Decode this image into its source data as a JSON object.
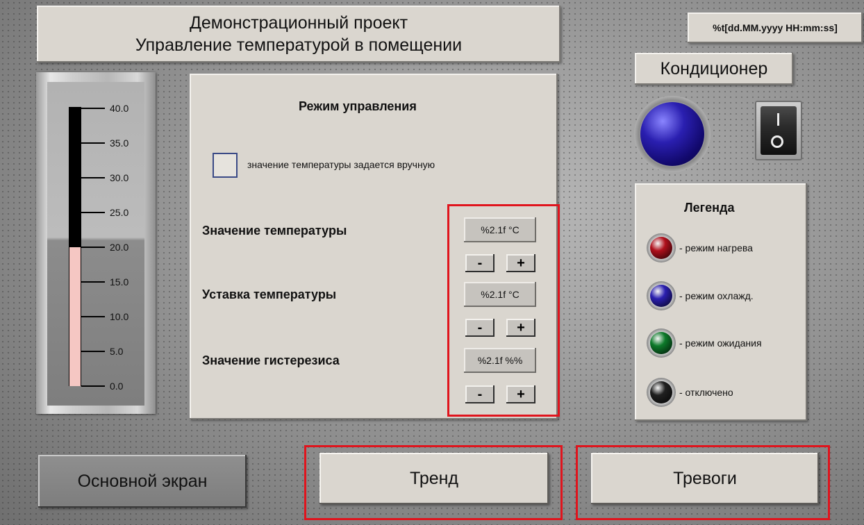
{
  "title": {
    "line1": "Демонстрационный проект",
    "line2": "Управление температурой в помещении"
  },
  "datetime_format": "%t[dd.MM.yyyy  HH:mm:ss]",
  "thermometer": {
    "scale": [
      "40.0",
      "35.0",
      "30.0",
      "25.0",
      "20.0",
      "15.0",
      "10.0",
      "5.0",
      "0.0"
    ],
    "level_celsius": 20.0,
    "max_celsius": 40.0
  },
  "mode": {
    "title": "Режим управления",
    "manual_checkbox_label": "значение температуры задается вручную",
    "manual_checked": false,
    "params": [
      {
        "label": "Значение температуры",
        "value": "%2.1f °C",
        "minus": "-",
        "plus": "+"
      },
      {
        "label": "Уставка температуры",
        "value": "%2.1f °C",
        "minus": "-",
        "plus": "+"
      },
      {
        "label": "Значение гистерезиса",
        "value": "%2.1f %%",
        "minus": "-",
        "plus": "+"
      }
    ]
  },
  "conditioner": {
    "title": "Кондиционер",
    "lamp_color": "#2a1fb0"
  },
  "legend": {
    "title": "Легенда",
    "items": [
      {
        "text": "- режим нагрева",
        "color": "#b0101c"
      },
      {
        "text": "- режим охлажд.",
        "color": "#2a1fb0"
      },
      {
        "text": "- режим ожидания",
        "color": "#0d7a2a"
      },
      {
        "text": "- отключено",
        "color": "#202020"
      }
    ]
  },
  "nav": {
    "main": "Основной экран",
    "trend": "Тренд",
    "alarms": "Тревоги"
  },
  "colors": {
    "highlight": "#e0141d",
    "thermo_fill": "#f5c7c3"
  }
}
